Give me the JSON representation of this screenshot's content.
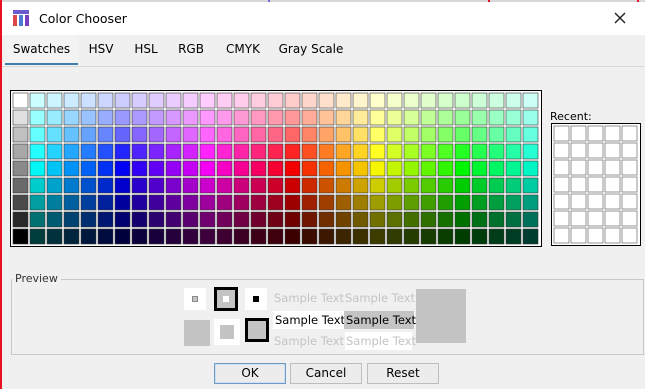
{
  "window": {
    "title": "Color Chooser"
  },
  "tabs": [
    {
      "label": "Swatches",
      "active": true
    },
    {
      "label": "HSV",
      "active": false
    },
    {
      "label": "HSL",
      "active": false
    },
    {
      "label": "RGB",
      "active": false
    },
    {
      "label": "CMYK",
      "active": false
    },
    {
      "label": "Gray Scale",
      "active": false
    }
  ],
  "swatches": {
    "columns": 31,
    "rows": 9
  },
  "recent": {
    "label": "Recent:",
    "columns": 5,
    "rows": 7
  },
  "preview": {
    "label": "Preview",
    "sample_text": "Sample Text",
    "preview_color": "#c4c4c4"
  },
  "buttons": {
    "ok": "OK",
    "cancel": "Cancel",
    "reset": "Reset"
  },
  "colors": {
    "tab_underline": "#3c7fb1",
    "window_edge": "#e81123"
  }
}
